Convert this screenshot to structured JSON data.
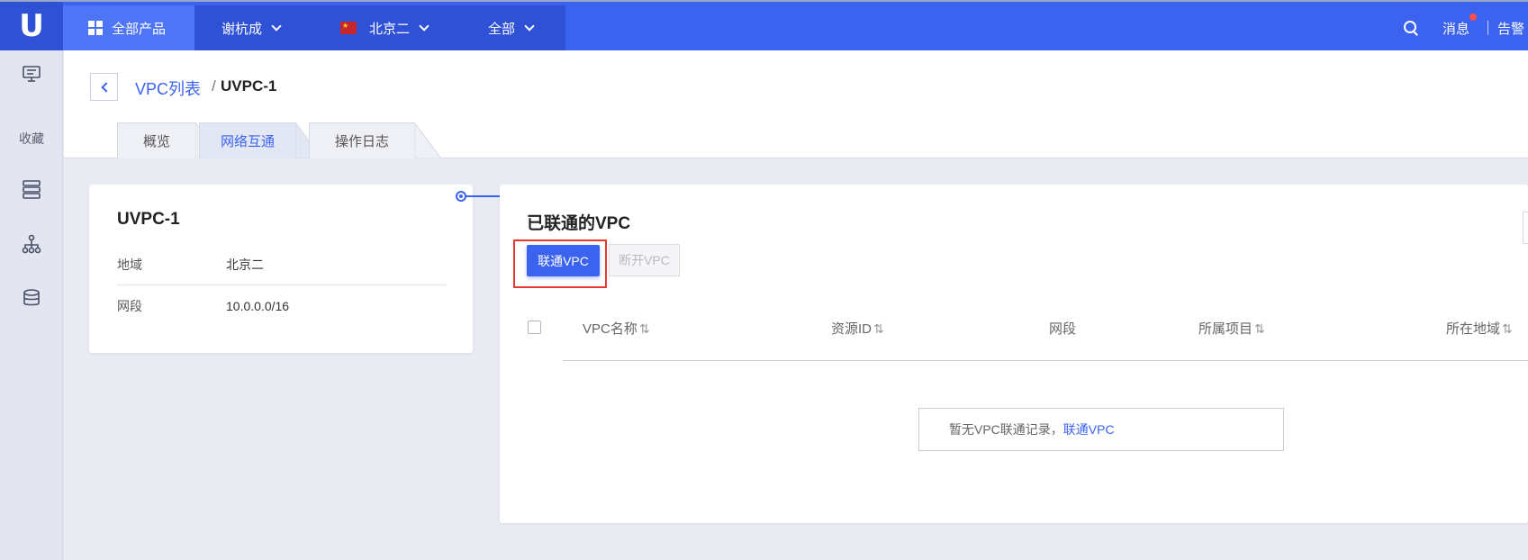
{
  "topbar": {
    "products": "全部产品",
    "user": "谢杭成",
    "region": "北京二",
    "scope": "全部",
    "messages": "消息",
    "alerts": "告警"
  },
  "sidebar": {
    "favorites": "收藏"
  },
  "breadcrumb": {
    "parent": "VPC列表",
    "separator": "/",
    "current": "UVPC-1"
  },
  "tabs": [
    {
      "label": "概览"
    },
    {
      "label": "网络互通"
    },
    {
      "label": "操作日志"
    }
  ],
  "vpc_card": {
    "title": "UVPC-1",
    "region_label": "地域",
    "region_value": "北京二",
    "cidr_label": "网段",
    "cidr_value": "10.0.0.0/16"
  },
  "connected": {
    "title": "已联通的VPC",
    "connect_button": "联通VPC",
    "disconnect_button": "断开VPC",
    "columns": [
      "VPC名称",
      "资源ID",
      "网段",
      "所属项目",
      "所在地域"
    ],
    "empty_text": "暂无VPC联通记录，",
    "empty_link": "联通VPC"
  },
  "colors": {
    "accent": "#3b63f0",
    "topbar": "#3b63f0",
    "highlight": "#e53935"
  }
}
